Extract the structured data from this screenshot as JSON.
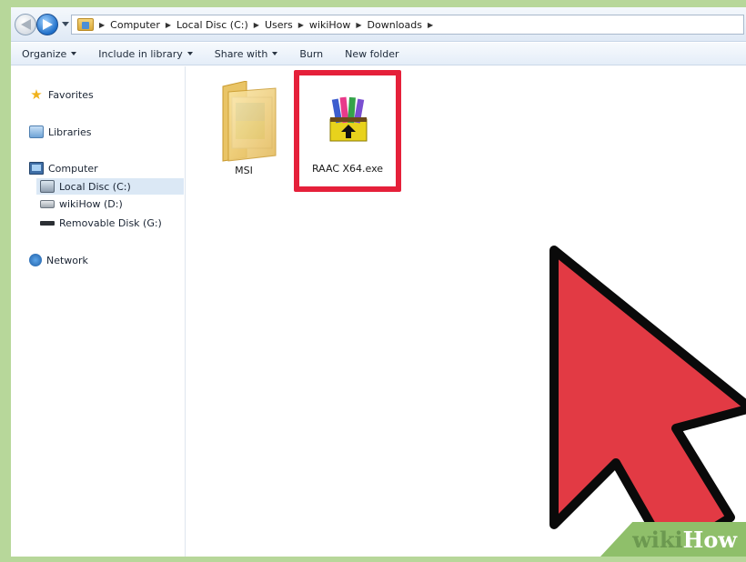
{
  "address_bar": {
    "breadcrumbs": [
      "Computer",
      "Local Disc (C:)",
      "Users",
      "wikiHow",
      "Downloads"
    ]
  },
  "command_bar": {
    "organize": "Organize",
    "include_in_library": "Include in library",
    "share_with": "Share with",
    "burn": "Burn",
    "new_folder": "New folder"
  },
  "nav_pane": {
    "favorites": "Favorites",
    "libraries": "Libraries",
    "computer": "Computer",
    "local_disc": "Local Disc (C:)",
    "wikihow_drive": "wikiHow (D:)",
    "removable_disk": "Removable Disk (G:)",
    "network": "Network"
  },
  "content": {
    "items": [
      {
        "name": "MSI",
        "type": "folder"
      },
      {
        "name": "RAAC X64.exe",
        "type": "archive-exe",
        "highlighted": true
      }
    ]
  },
  "annotation": {
    "highlight_color": "#e5203a",
    "pointer_color": "#e23a44"
  },
  "watermark": {
    "part1": "wiki",
    "part2": "How"
  }
}
